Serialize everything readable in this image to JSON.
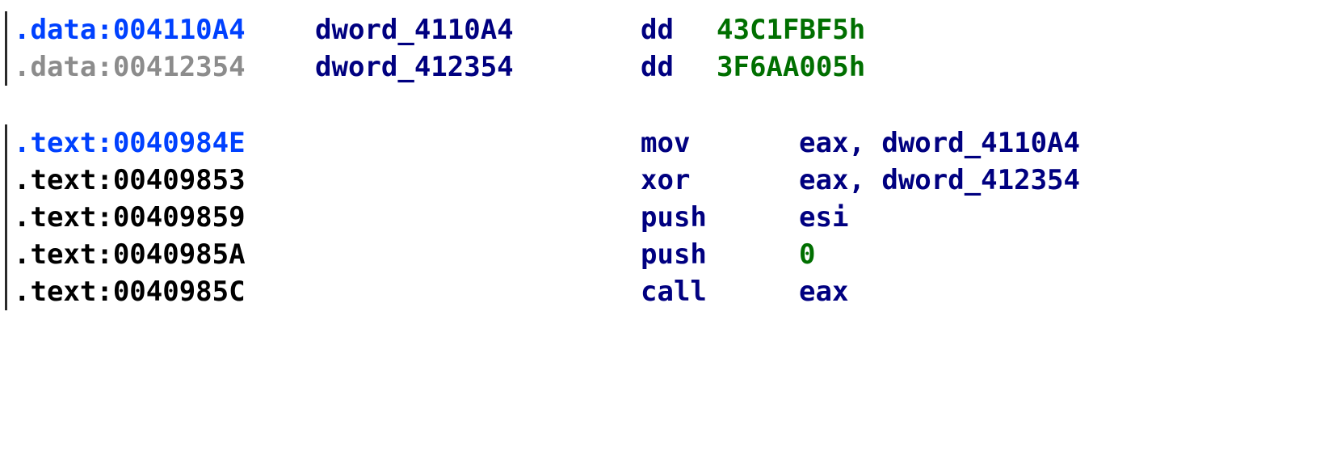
{
  "data_section": [
    {
      "address": ".data:004110A4",
      "name": "dword_4110A4",
      "directive": "dd",
      "value": "43C1FBF5h",
      "state": "current"
    },
    {
      "address": ".data:00412354",
      "name": "dword_412354",
      "directive": "dd",
      "value": "3F6AA005h",
      "state": "dim"
    }
  ],
  "text_section": [
    {
      "address": ".text:0040984E",
      "mnemonic": "mov",
      "operand": "eax, dword_4110A4",
      "state": "current"
    },
    {
      "address": ".text:00409853",
      "mnemonic": "xor",
      "operand": "eax, dword_412354",
      "state": "normal"
    },
    {
      "address": ".text:00409859",
      "mnemonic": "push",
      "operand": "esi",
      "state": "normal"
    },
    {
      "address": ".text:0040985A",
      "mnemonic": "push",
      "operand": "0",
      "state": "normal"
    },
    {
      "address": ".text:0040985C",
      "mnemonic": "call",
      "operand": "eax",
      "state": "normal"
    }
  ],
  "colors": {
    "address_current": "#0041ff",
    "address_dim": "#8c8c8c",
    "address_normal": "#000000",
    "code": "#000080",
    "literal": "#006f00",
    "background": "#ffffff"
  }
}
